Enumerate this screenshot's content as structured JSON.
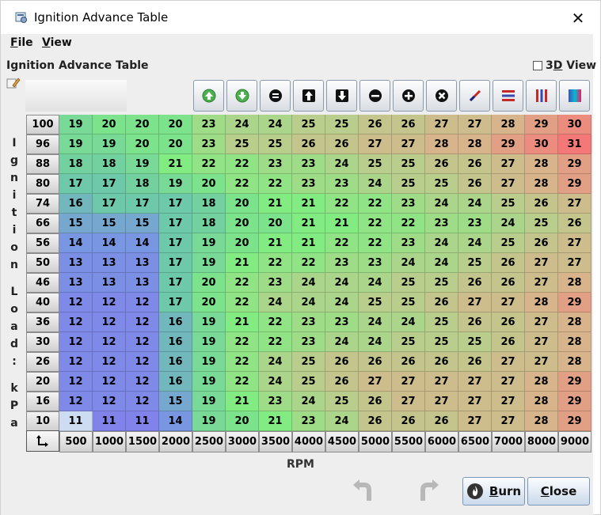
{
  "window": {
    "title": "Ignition Advance Table",
    "close_symbol": "✕"
  },
  "menu": [
    {
      "first": "F",
      "rest": "ile"
    },
    {
      "first": "V",
      "rest": "iew"
    }
  ],
  "section_title": "Ignition Advance Table",
  "view3d_label": {
    "first": "3",
    "under": "D",
    "rest": " View"
  },
  "view3d_checked": false,
  "toolbar_icons": [
    "increment-green-icon",
    "decrement-green-icon",
    "set-equal-icon",
    "shift-up-icon",
    "shift-down-icon",
    "decrease-icon",
    "increase-icon",
    "multiply-icon",
    "interpolate-icon",
    "horizontal-interpolate-icon",
    "vertical-interpolate-icon",
    "color-gradient-icon"
  ],
  "y_axis_title": "Ignition Load: kPa",
  "x_axis_title": "RPM",
  "load_bins": [
    100,
    96,
    88,
    80,
    74,
    66,
    56,
    50,
    46,
    40,
    36,
    30,
    26,
    20,
    16,
    10
  ],
  "rpm_bins": [
    500,
    1000,
    1500,
    2000,
    2500,
    3000,
    3500,
    4000,
    4500,
    5000,
    5500,
    6000,
    6500,
    7000,
    8000,
    9000
  ],
  "table": [
    [
      19,
      20,
      20,
      20,
      23,
      24,
      24,
      25,
      25,
      26,
      26,
      27,
      27,
      28,
      29,
      30
    ],
    [
      19,
      19,
      20,
      20,
      23,
      25,
      25,
      26,
      26,
      27,
      27,
      28,
      28,
      29,
      30,
      31
    ],
    [
      18,
      18,
      19,
      21,
      22,
      22,
      23,
      23,
      24,
      25,
      25,
      26,
      26,
      27,
      28,
      29
    ],
    [
      17,
      17,
      18,
      19,
      20,
      22,
      22,
      23,
      23,
      24,
      25,
      25,
      26,
      27,
      28,
      29
    ],
    [
      16,
      17,
      17,
      17,
      18,
      20,
      21,
      21,
      22,
      22,
      23,
      24,
      24,
      25,
      26,
      27
    ],
    [
      15,
      15,
      15,
      17,
      18,
      20,
      20,
      21,
      21,
      22,
      22,
      23,
      23,
      24,
      25,
      26,
      27
    ],
    [
      14,
      14,
      14,
      17,
      19,
      20,
      21,
      21,
      22,
      22,
      23,
      24,
      24,
      25,
      26,
      27
    ],
    [
      13,
      13,
      13,
      17,
      19,
      21,
      22,
      22,
      23,
      23,
      24,
      24,
      25,
      26,
      27,
      27
    ],
    [
      13,
      13,
      13,
      17,
      20,
      22,
      23,
      24,
      24,
      24,
      25,
      25,
      26,
      26,
      27,
      28
    ],
    [
      12,
      12,
      12,
      17,
      20,
      22,
      24,
      24,
      24,
      25,
      25,
      26,
      27,
      27,
      28,
      29
    ],
    [
      12,
      12,
      12,
      16,
      19,
      21,
      22,
      23,
      23,
      24,
      24,
      25,
      26,
      26,
      27,
      28
    ],
    [
      12,
      12,
      12,
      16,
      19,
      22,
      22,
      23,
      24,
      24,
      25,
      25,
      25,
      26,
      27,
      28
    ],
    [
      12,
      12,
      12,
      16,
      19,
      22,
      24,
      25,
      26,
      26,
      26,
      26,
      26,
      27,
      27,
      28
    ],
    [
      12,
      12,
      12,
      16,
      19,
      22,
      24,
      25,
      26,
      27,
      27,
      27,
      27,
      27,
      28,
      29
    ],
    [
      12,
      12,
      12,
      15,
      19,
      21,
      23,
      24,
      25,
      26,
      27,
      27,
      27,
      27,
      28,
      29
    ],
    [
      11,
      11,
      11,
      14,
      19,
      20,
      21,
      23,
      24,
      26,
      26,
      26,
      27,
      27,
      28,
      29
    ]
  ],
  "buttons": {
    "burn_first": "B",
    "burn_rest": "urn",
    "close_first": "C",
    "close_rest": "lose"
  }
}
